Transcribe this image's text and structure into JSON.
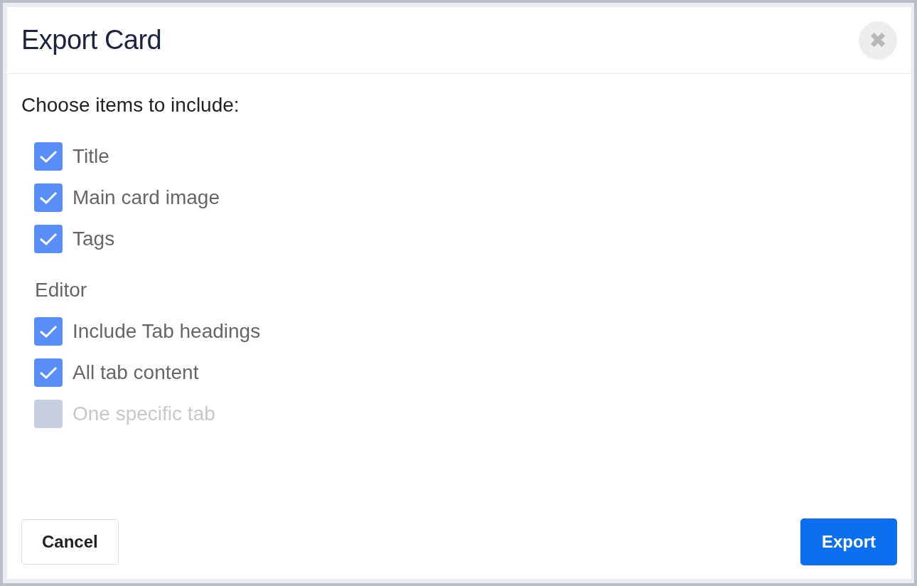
{
  "dialog": {
    "title": "Export Card",
    "close_label": "✖"
  },
  "prompt": "Choose items to include:",
  "groups": [
    {
      "items": [
        {
          "label": "Title",
          "checked": true,
          "disabled": false
        },
        {
          "label": "Main card image",
          "checked": true,
          "disabled": false
        },
        {
          "label": "Tags",
          "checked": true,
          "disabled": false
        }
      ]
    },
    {
      "heading": "Editor",
      "items": [
        {
          "label": "Include Tab headings",
          "checked": true,
          "disabled": false
        },
        {
          "label": "All tab content",
          "checked": true,
          "disabled": false
        },
        {
          "label": "One specific tab",
          "checked": false,
          "disabled": true
        }
      ]
    }
  ],
  "buttons": [
    {
      "label": "Cancel",
      "kind": "secondary"
    },
    {
      "label": "Export",
      "kind": "primary"
    }
  ]
}
